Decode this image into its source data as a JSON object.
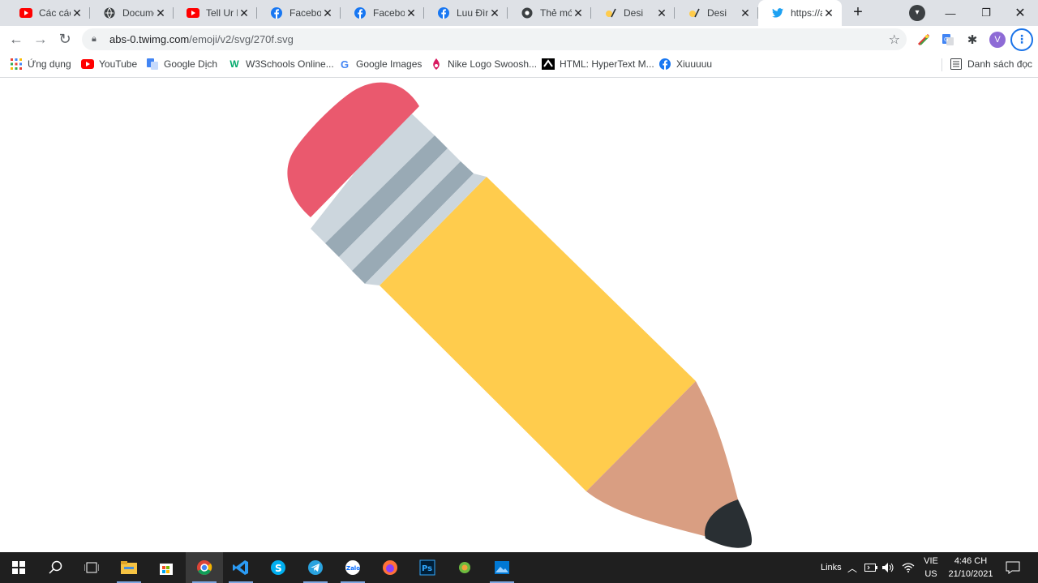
{
  "tabs": [
    {
      "title": "Các cách",
      "icon": "youtube-icon"
    },
    {
      "title": "Docume",
      "icon": "globe-icon"
    },
    {
      "title": "Tell Ur M",
      "icon": "youtube-icon"
    },
    {
      "title": "Faceboo",
      "icon": "facebook-icon"
    },
    {
      "title": "Faceboo",
      "icon": "facebook-icon"
    },
    {
      "title": "Luu Đình",
      "icon": "facebook-icon"
    },
    {
      "title": "Thẻ mới",
      "icon": "chrome-icon"
    },
    {
      "title": "Desi",
      "icon": "pencil-emoji-icon"
    },
    {
      "title": "Desi",
      "icon": "pencil-emoji-icon"
    },
    {
      "title": "https://a",
      "icon": "twitter-icon"
    }
  ],
  "address": {
    "host": "abs-0.twimg.com",
    "path": "/emoji/v2/svg/270f.svg"
  },
  "bookmarks": [
    {
      "label": "Ứng dụng",
      "icon": "apps-grid-icon"
    },
    {
      "label": "YouTube",
      "icon": "youtube-icon"
    },
    {
      "label": "Google Dịch",
      "icon": "google-translate-icon"
    },
    {
      "label": "W3Schools Online...",
      "icon": "w3schools-icon"
    },
    {
      "label": "Google Images",
      "icon": "google-icon"
    },
    {
      "label": "Nike Logo Swoosh...",
      "icon": "nike-icon"
    },
    {
      "label": "HTML: HyperText M...",
      "icon": "mdn-icon"
    },
    {
      "label": "Xiuuuuu",
      "icon": "facebook-icon"
    }
  ],
  "reading_list": "Danh sách đọc",
  "profile_initial": "V",
  "taskbar": {
    "links_label": "Links",
    "lang_line1": "VIE",
    "lang_line2": "US",
    "time": "4:46 CH",
    "date": "21/10/2021"
  },
  "colors": {
    "eraser": "#ea596e",
    "ferrule_light": "#ccd6dd",
    "ferrule_dark": "#99aab5",
    "body": "#ffcc4d",
    "wood": "#d99e82",
    "lead": "#292f33"
  }
}
